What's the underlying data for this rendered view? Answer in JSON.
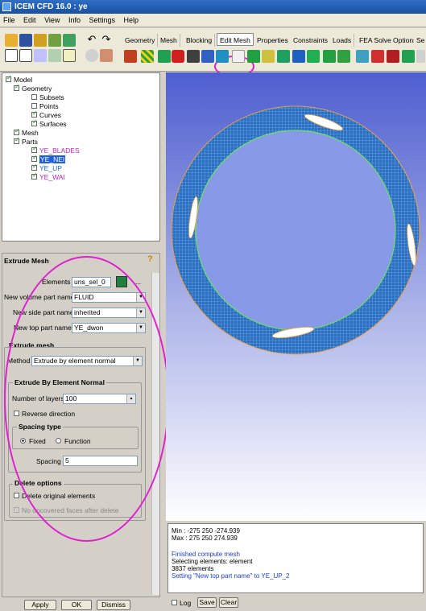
{
  "window": {
    "title": "ICEM CFD 16.0 : ye"
  },
  "menu": [
    "File",
    "Edit",
    "View",
    "Info",
    "Settings",
    "Help"
  ],
  "tabs": [
    "Geometry",
    "Mesh",
    "Blocking",
    "Edit Mesh",
    "Properties",
    "Constraints",
    "Loads",
    "FEA Solve Options",
    "Se"
  ],
  "active_tab": "Edit Mesh",
  "tree": {
    "model": "Model",
    "geometry": "Geometry",
    "subsets": "Subsets",
    "points": "Points",
    "curves": "Curves",
    "surfaces": "Surfaces",
    "mesh": "Mesh",
    "parts": "Parts",
    "part_items": [
      "YE_BLADES",
      "YE_NEI",
      "YE_UP",
      "YE_WAI"
    ]
  },
  "panel": {
    "title": "Extrude Mesh",
    "elements_label": "Elements",
    "elements_value": "uns_sel_0",
    "elements_more": "...",
    "new_volume_label": "New volume part name",
    "new_volume_value": "FLUID",
    "new_side_label": "New side part name",
    "new_side_value": "inherited",
    "new_top_label": "New top part name",
    "new_top_value": "YE_dwon",
    "extrude_mesh_group": "Extrude mesh",
    "method_label": "Method",
    "method_value": "Extrude by element normal",
    "normal_group": "Extrude By Element Normal",
    "layers_label": "Number of layers",
    "layers_value": "100",
    "reverse_label": "Reverse direction",
    "spacing_type_group": "Spacing type",
    "fixed_label": "Fixed",
    "function_label": "Function",
    "spacing_label": "Spacing",
    "spacing_value": "5",
    "delete_group": "Delete options",
    "delete_original_label": "Delete original elements",
    "no_uncovered_label": "No uncovered faces after delete"
  },
  "buttons": {
    "apply": "Apply",
    "ok": "OK",
    "dismiss": "Dismiss"
  },
  "console": {
    "lines": [
      {
        "text": "Min : -275 250 -274.939",
        "color": "#000000"
      },
      {
        "text": "Max : 275 250 274.939",
        "color": "#000000"
      },
      {
        "text": "",
        "color": "#000000"
      },
      {
        "text": "Finished compute mesh",
        "color": "#1a3fd0"
      },
      {
        "text": "Selecting elements: element",
        "color": "#000000"
      },
      {
        "text": "3837 elements",
        "color": "#000000"
      },
      {
        "text": "Setting \"New top part name\" to YE_UP_2",
        "color": "#1a3fd0"
      }
    ],
    "log_label": "Log",
    "save_label": "Save",
    "clear_label": "Clear"
  },
  "colors": {
    "part_magenta": "#c020c0",
    "part_selected_bg": "#1f5fd8",
    "annotation": "#e020d0",
    "mesh": "#1f66b8",
    "edge_green": "#6ee060",
    "edge_orange": "#f0a040"
  }
}
